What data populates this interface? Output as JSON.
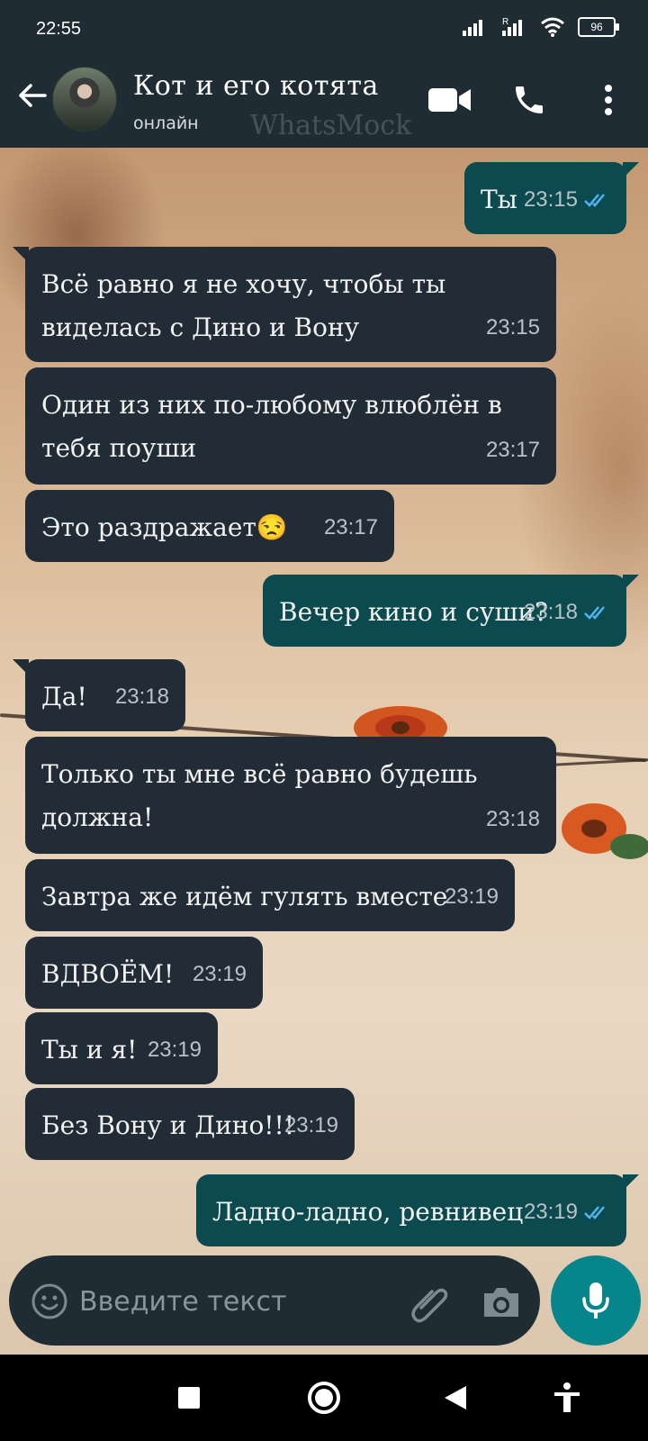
{
  "status_bar": {
    "time": "22:55",
    "battery": "96"
  },
  "header": {
    "title": "Кот и его котята",
    "status": "онлайн",
    "watermark": "WhatsMock"
  },
  "messages": [
    {
      "direction": "out",
      "text": "Ты",
      "time": "23:15",
      "read": true
    },
    {
      "direction": "in",
      "text": "Всё равно я не хочу, чтобы ты виделась с Дино и Вону",
      "time": "23:15"
    },
    {
      "direction": "in",
      "text": "Один из них по-любому влюблён в тебя поуши",
      "time": "23:17"
    },
    {
      "direction": "in",
      "text": "Это раздражает😒",
      "time": "23:17"
    },
    {
      "direction": "out",
      "text": "Вечер кино и суши?",
      "time": "23:18",
      "read": true
    },
    {
      "direction": "in",
      "text": "Да!",
      "time": "23:18"
    },
    {
      "direction": "in",
      "text": "Только ты мне всё равно будешь должна!",
      "time": "23:18"
    },
    {
      "direction": "in",
      "text": "Завтра же идём гулять вместе",
      "time": "23:19"
    },
    {
      "direction": "in",
      "text": "ВДВОЁМ!",
      "time": "23:19"
    },
    {
      "direction": "in",
      "text": "Ты и я!",
      "time": "23:19"
    },
    {
      "direction": "in",
      "text": "Без Вону и Дино!!!",
      "time": "23:19"
    },
    {
      "direction": "out",
      "text": "Ладно-ладно, ревнивец",
      "time": "23:19",
      "read": true
    }
  ],
  "input": {
    "placeholder": "Введите текст"
  },
  "icons": {
    "back": "arrow-left-icon",
    "video": "video-camera-icon",
    "call": "phone-icon",
    "menu": "more-vertical-icon",
    "emoji": "emoji-icon",
    "attach": "paperclip-icon",
    "camera": "camera-icon",
    "mic": "microphone-icon",
    "read_receipt": "double-check-icon"
  },
  "colors": {
    "header": "#1f2c34",
    "incoming_bubble": "#212c36",
    "outgoing_bubble": "#0b4a4e",
    "accent": "#06858b",
    "read_tick": "#4fb5f0"
  }
}
